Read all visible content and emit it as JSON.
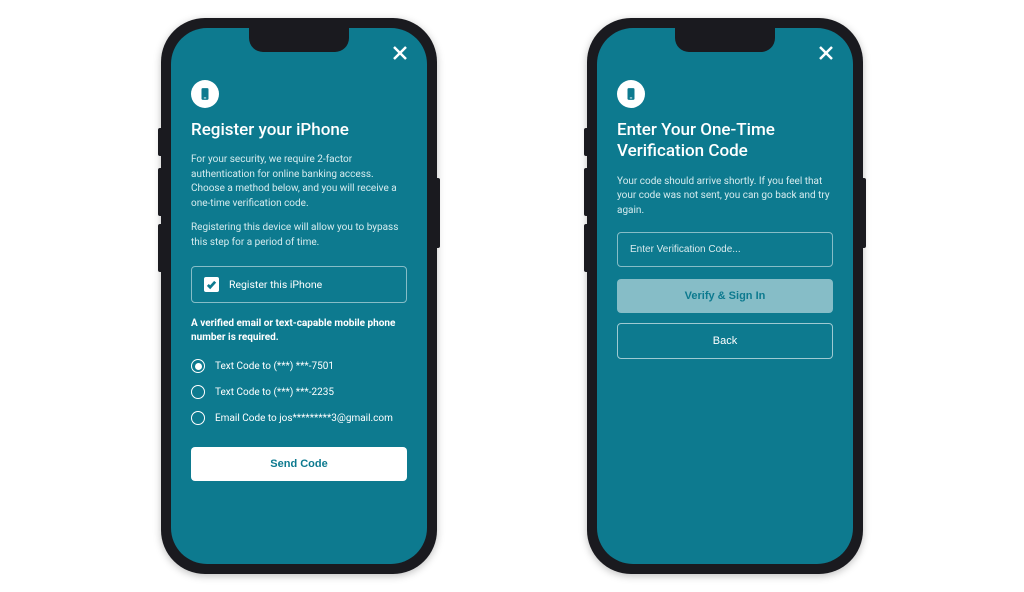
{
  "colors": {
    "bg": "#0d7a8f",
    "accent_text": "#ffffff"
  },
  "left": {
    "title": "Register your iPhone",
    "desc1": "For your security, we require 2-factor authentication for online banking access. Choose a method below, and you will receive a one-time verification code.",
    "desc2": "Registering this device will allow you to bypass this step for a period of time.",
    "checkbox_label": "Register this iPhone",
    "checkbox_checked": true,
    "requirement": "A verified email or text-capable mobile phone number is required.",
    "options": [
      {
        "label": "Text Code to (***) ***-7501",
        "selected": true
      },
      {
        "label": "Text Code to (***) ***-2235",
        "selected": false
      },
      {
        "label": "Email Code to jos*********3@gmail.com",
        "selected": false
      }
    ],
    "send_label": "Send Code"
  },
  "right": {
    "title": "Enter Your One-Time Verification Code",
    "desc": "Your code should arrive shortly. If you feel that your code was not sent, you can go back and try again.",
    "placeholder": "Enter Verification Code...",
    "verify_label": "Verify & Sign In",
    "back_label": "Back"
  }
}
